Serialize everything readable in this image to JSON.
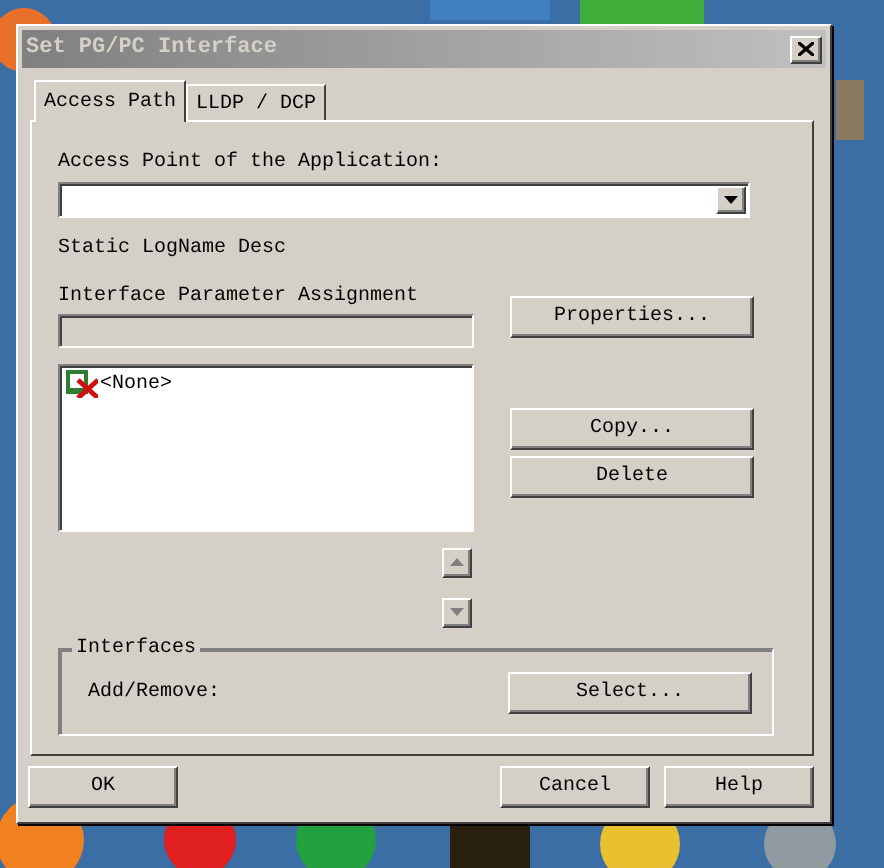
{
  "window": {
    "title": "Set PG/PC Interface"
  },
  "tabs": [
    {
      "label": "Access Path",
      "selected": true
    },
    {
      "label": "LLDP / DCP",
      "selected": false
    }
  ],
  "access_point": {
    "label": "Access Point of the Application:"
  },
  "static_text": "Static LogName Desc",
  "parameter_assignment": {
    "label": "Interface Parameter Assignment",
    "items": [
      {
        "label": "<None>",
        "selected": false
      }
    ]
  },
  "side_button_groups": [
    [
      "Properties..."
    ],
    [
      "Copy...",
      "Delete"
    ]
  ],
  "interfaces": {
    "title": "Interfaces",
    "label": "Add/Remove:",
    "button": "Select..."
  },
  "footer_left_buttons": [
    "OK"
  ],
  "footer_right_buttons": [
    "Cancel",
    "Help"
  ]
}
